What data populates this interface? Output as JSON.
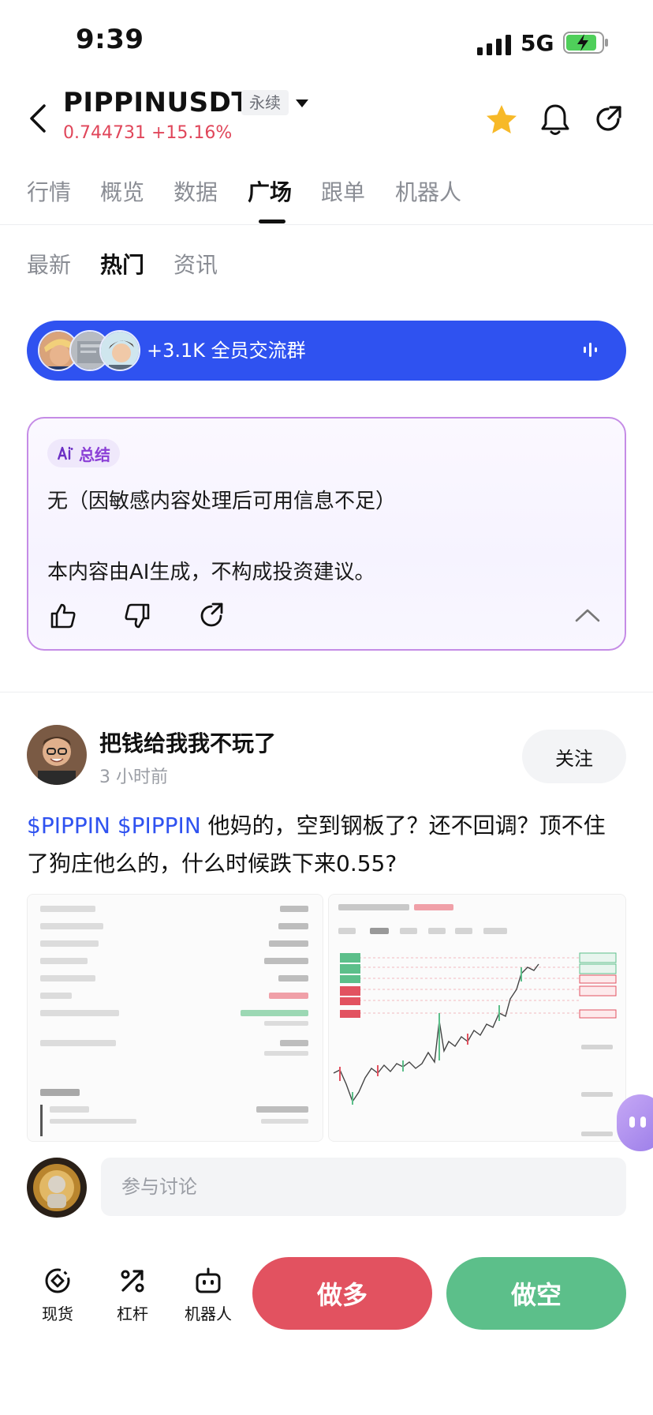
{
  "status": {
    "time": "9:39",
    "network": "5G"
  },
  "header": {
    "symbol": "PIPPINUSDT",
    "contract_type": "永续",
    "price": "0.744731",
    "change": "+15.16%"
  },
  "main_tabs": [
    "行情",
    "概览",
    "数据",
    "广场",
    "跟单",
    "机器人"
  ],
  "main_tab_active": "广场",
  "sub_tabs": [
    "最新",
    "热门",
    "资讯"
  ],
  "sub_tab_active": "热门",
  "group_banner": {
    "text": "+3.1K 全员交流群"
  },
  "ai_summary": {
    "chip": "总结",
    "line1": "无（因敏感内容处理后可用信息不足）",
    "line2": "本内容由AI生成，不构成投资建议。"
  },
  "post": {
    "author": "把钱给我我不玩了",
    "time": "3 小时前",
    "follow": "关注",
    "tags": "$PIPPIN $PIPPIN",
    "text": " 他妈的，空到钢板了？还不回调？顶不住了狗庄他么的，什么时候跌下来0.55?"
  },
  "comment": {
    "placeholder": "参与讨论"
  },
  "bottom_bar": {
    "spot": "现货",
    "leverage": "杠杆",
    "robot": "机器人",
    "long": "做多",
    "short": "做空"
  },
  "colors": {
    "accent_blue": "#2f52f0",
    "up_red": "#e0465a",
    "long_red": "#e25260",
    "short_green": "#5cbf8a",
    "ai_purple": "#8b3fd6"
  }
}
